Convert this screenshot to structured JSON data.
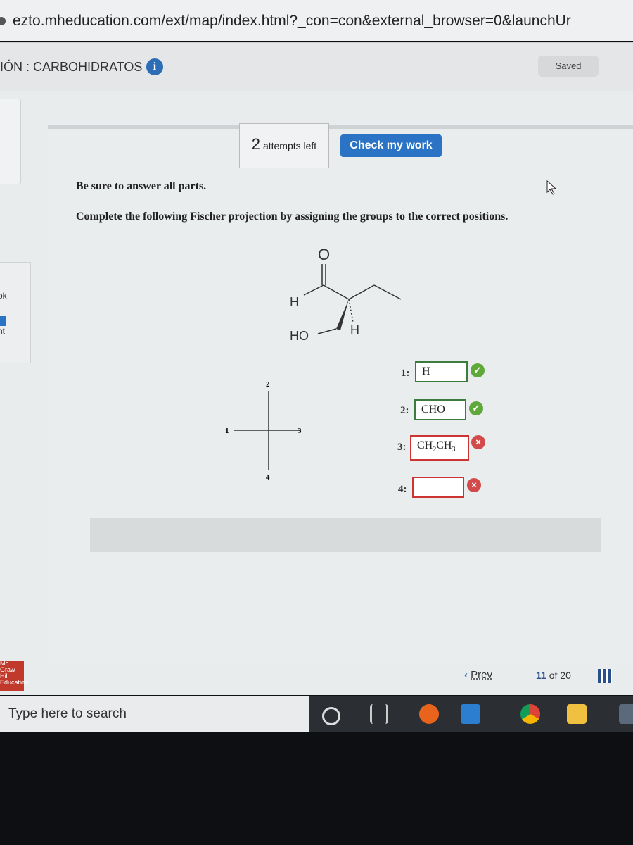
{
  "browser": {
    "url": "ezto.mheducation.com/ext/map/index.html?_con=con&external_browser=0&launchUr"
  },
  "header": {
    "title": "IÓN : CARBOHIDRATOS",
    "info_icon": "i",
    "saved": "Saved"
  },
  "sidebar": {
    "partial_labels": [
      "ok",
      "nt"
    ]
  },
  "question": {
    "attempts_count": "2",
    "attempts_label": "attempts left",
    "check_button": "Check my work",
    "instruction": "Be sure to answer all parts.",
    "prompt": "Complete the following Fischer projection by assigning the groups to the correct positions."
  },
  "molecule": {
    "o": "O",
    "h1": "H",
    "ho": "HO",
    "h2": "H"
  },
  "fischer": {
    "p1": "1",
    "p2": "2",
    "p3": "3",
    "p4": "4"
  },
  "answers": [
    {
      "label": "1:",
      "value": "H",
      "status": "correct"
    },
    {
      "label": "2:",
      "value": "CHO",
      "status": "correct"
    },
    {
      "label": "3:",
      "value": "CH2CH3",
      "status": "incorrect"
    },
    {
      "label": "4:",
      "value": "",
      "status": "incorrect"
    }
  ],
  "footer": {
    "logo": "Mc Graw Hill Education",
    "prev": "Prev",
    "page_current": "11",
    "page_of": "of",
    "page_total": "20"
  },
  "taskbar": {
    "search_placeholder": "Type here to search"
  },
  "colors": {
    "accent": "#2b73c4",
    "correct": "#5fa93a",
    "incorrect": "#d24a4a"
  }
}
